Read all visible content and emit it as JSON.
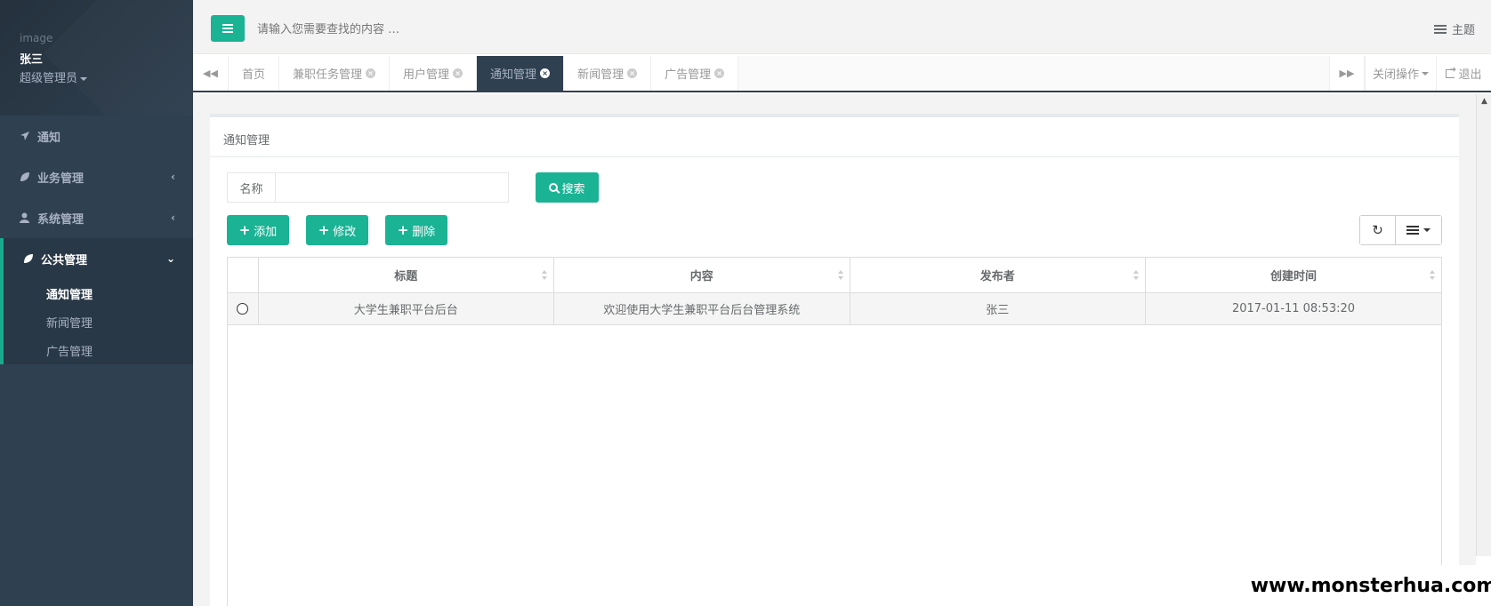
{
  "profile": {
    "image_alt": "image",
    "name": "张三",
    "role": "超级管理员"
  },
  "sidebar": {
    "items": [
      {
        "label": "通知",
        "icon": "paper-plane-icon"
      },
      {
        "label": "业务管理",
        "icon": "leaf-icon"
      },
      {
        "label": "系统管理",
        "icon": "user-icon"
      },
      {
        "label": "公共管理",
        "icon": "leaf-icon"
      }
    ],
    "submenu": [
      "通知管理",
      "新闻管理",
      "广告管理"
    ]
  },
  "header": {
    "search_placeholder": "请输入您需要查找的内容 …",
    "theme_label": "主题"
  },
  "tabs": [
    {
      "label": "首页"
    },
    {
      "label": "兼职任务管理"
    },
    {
      "label": "用户管理"
    },
    {
      "label": "通知管理"
    },
    {
      "label": "新闻管理"
    },
    {
      "label": "广告管理"
    }
  ],
  "tab_controls": {
    "close_ops": "关闭操作",
    "logout": "退出"
  },
  "panel": {
    "title": "通知管理",
    "name_label": "名称",
    "name_value": "",
    "search_btn": "搜索",
    "add_btn": "添加",
    "edit_btn": "修改",
    "delete_btn": "删除"
  },
  "table": {
    "headers": [
      "标题",
      "内容",
      "发布者",
      "创建时间"
    ],
    "rows": [
      [
        "大学生兼职平台后台",
        "欢迎使用大学生兼职平台后台管理系统",
        "张三",
        "2017-01-11 08:53:20"
      ]
    ]
  },
  "watermark": "www.monsterhua.com",
  "colors": {
    "sidebar": "#2f4050",
    "accent": "#1ab394"
  }
}
